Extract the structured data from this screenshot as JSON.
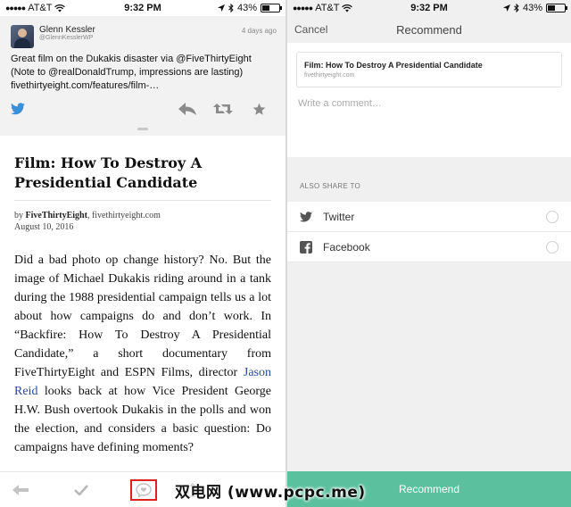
{
  "status_left": {
    "carrier": "AT&T",
    "time": "9:32 PM",
    "battery": "43%",
    "battery_level": 0.43
  },
  "status_right": {
    "carrier": "AT&T",
    "time": "9:32 PM",
    "battery": "43%",
    "battery_level": 0.43
  },
  "tweet": {
    "name": "Glenn Kessler",
    "handle": "@GlennKesslerWP",
    "age": "4 days ago",
    "text": "Great film on the Dukakis disaster via @FiveThirtyEight (Note to @realDonaldTrump, impressions are lasting) fivethirtyeight.com/features/film-…",
    "icons": [
      "twitter-icon",
      "reply-icon",
      "retweet-icon",
      "favorite-icon"
    ]
  },
  "article": {
    "title": "Film: How To Destroy A Presidential Candidate",
    "by_prefix": "by",
    "author": "FiveThirtyEight",
    "source": ", fivethirtyeight.com",
    "date": "August 10, 2016",
    "body_1": "Did a bad photo op change history? No. But the image of Michael Dukakis riding around in a tank during the 1988 presidential campaign tells us a lot about how campaigns do and don’t work. In “Backfire: How To Destroy A Presidential Candidate,” a short documentary from FiveThirtyEight and ESPN Films, director ",
    "link": "Jason Reid",
    "body_2": " looks back at how Vice President George H.W. Bush overtook Dukakis in the polls and won the election, and considers a basic question: Do campaigns have defining moments?"
  },
  "toolbar": {
    "icons": [
      "back-icon",
      "check-icon",
      "recommend-icon",
      "share-icon"
    ]
  },
  "recommend": {
    "cancel": "Cancel",
    "title": "Recommend",
    "link_title": "Film: How To Destroy A Presidential Candidate",
    "link_domain": "fivethirtyeight.com",
    "comment_placeholder": "Write a comment…",
    "also_share": "ALSO SHARE TO",
    "share_targets": [
      {
        "label": "Twitter",
        "icon": "twitter-icon"
      },
      {
        "label": "Facebook",
        "icon": "facebook-icon"
      }
    ],
    "button": "Recommend"
  },
  "colors": {
    "accent": "#5bc09d",
    "twitter_blue": "#3a8fd8",
    "link": "#2a4c9c",
    "highlight": "#dd2222"
  },
  "watermark": "双电网 (www.pcpc.me)"
}
